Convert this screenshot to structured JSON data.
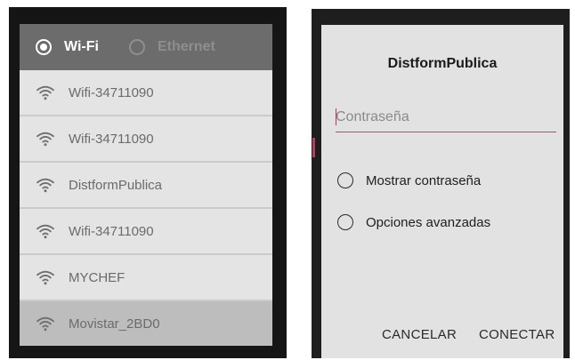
{
  "connection": {
    "wifi_label": "Wi-Fi",
    "ethernet_label": "Ethernet",
    "selected": "wifi"
  },
  "networks": [
    {
      "name": "Wifi-34711090",
      "icon": "wifi-signal-icon"
    },
    {
      "name": "Wifi-34711090",
      "icon": "wifi-signal-icon"
    },
    {
      "name": "DistformPublica",
      "icon": "wifi-signal-icon"
    },
    {
      "name": "Wifi-34711090",
      "icon": "wifi-signal-icon"
    },
    {
      "name": "MYCHEF",
      "icon": "wifi-signal-icon"
    },
    {
      "name": "Movistar_2BD0",
      "icon": "wifi-signal-icon"
    }
  ],
  "dialog": {
    "title": "DistformPublica",
    "password_placeholder": "Contraseña",
    "password_value": "",
    "show_password_label": "Mostrar contraseña",
    "advanced_options_label": "Opciones avanzadas",
    "cancel_label": "CANCELAR",
    "connect_label": "CONECTAR"
  },
  "colors": {
    "header_bg": "#6c6c6c",
    "list_bg": "#e4e4e4",
    "selected_bg": "#bdbdbd",
    "dialog_bg": "#e2e2e2",
    "accent": "#c03050"
  }
}
